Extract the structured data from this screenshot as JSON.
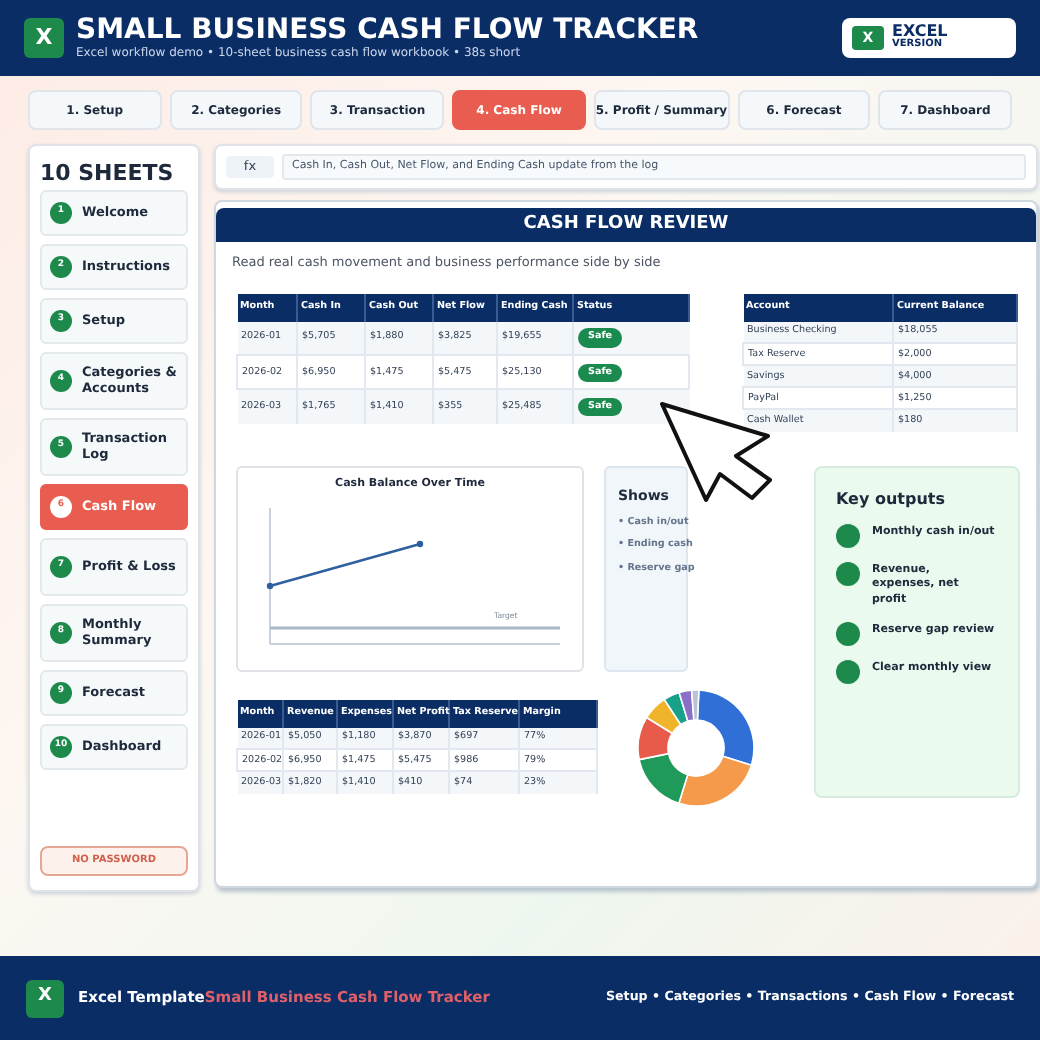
{
  "header": {
    "logo": "X",
    "title": "SMALL BUSINESS CASH FLOW TRACKER",
    "subtitle": "Excel workflow demo • 10-sheet business cash flow workbook • 38s short",
    "badge": {
      "logo": "X",
      "line1": "EXCEL",
      "line2": "VERSION"
    }
  },
  "tabs": [
    {
      "label": "1. Setup",
      "selected": false
    },
    {
      "label": "2. Categories",
      "selected": false
    },
    {
      "label": "3. Transaction",
      "selected": false
    },
    {
      "label": "4. Cash Flow",
      "selected": true
    },
    {
      "label": "5. Profit / Summary",
      "selected": false
    },
    {
      "label": "6. Forecast",
      "selected": false
    },
    {
      "label": "7. Dashboard",
      "selected": false
    }
  ],
  "sidebar": {
    "title": "10 SHEETS",
    "items": [
      {
        "number": "1",
        "label": "Welcome",
        "selected": false
      },
      {
        "number": "2",
        "label": "Instructions",
        "selected": false
      },
      {
        "number": "3",
        "label": "Setup",
        "selected": false
      },
      {
        "number": "4",
        "label": "Categories & Accounts",
        "selected": false
      },
      {
        "number": "5",
        "label": "Transaction Log",
        "selected": false
      },
      {
        "number": "6",
        "label": "Cash Flow",
        "selected": true
      },
      {
        "number": "7",
        "label": "Profit & Loss",
        "selected": false
      },
      {
        "number": "8",
        "label": "Monthly Summary",
        "selected": false
      },
      {
        "number": "9",
        "label": "Forecast",
        "selected": false
      },
      {
        "number": "10",
        "label": "Dashboard",
        "selected": false
      }
    ],
    "footer_button": "NO PASSWORD"
  },
  "formula_bar": {
    "fx": "fx",
    "text": "Cash In, Cash Out, Net Flow, and Ending Cash update from the log"
  },
  "review": {
    "title": "CASH FLOW REVIEW",
    "subtitle": "Read real cash movement and business performance side by side",
    "cash_table": {
      "columns": [
        "Month",
        "Cash In",
        "Cash Out",
        "Net Flow",
        "Ending Cash",
        "Status"
      ],
      "rows": [
        {
          "cells": [
            "2026-01",
            "$5,705",
            "$1,880",
            "$3,825",
            "$19,655"
          ],
          "status": "Safe"
        },
        {
          "cells": [
            "2026-02",
            "$6,950",
            "$1,475",
            "$5,475",
            "$25,130"
          ],
          "status": "Safe"
        },
        {
          "cells": [
            "2026-03",
            "$1,765",
            "$1,410",
            "$355",
            "$25,485"
          ],
          "status": "Safe"
        }
      ]
    },
    "accounts_table": {
      "columns": [
        "Account",
        "Current Balance"
      ],
      "rows": [
        [
          "Business Checking",
          "$18,055"
        ],
        [
          "Tax Reserve",
          "$2,000"
        ],
        [
          "Savings",
          "$4,000"
        ],
        [
          "PayPal",
          "$1,250"
        ],
        [
          "Cash Wallet",
          "$180"
        ]
      ]
    },
    "chart": {
      "title": "Cash Balance Over Time",
      "target_label": "Target"
    },
    "shows": {
      "title": "Shows",
      "items": [
        "• Cash in/out",
        "• Ending cash",
        "• Reserve gap"
      ]
    },
    "key_outputs": {
      "title": "Key outputs",
      "items": [
        "Monthly cash in/out",
        "Revenue, expenses, net profit",
        "Reserve gap review",
        "Clear monthly view"
      ]
    },
    "pl_table": {
      "columns": [
        "Month",
        "Revenue",
        "Expenses",
        "Net Profit",
        "Tax Reserve",
        "Margin"
      ],
      "rows": [
        [
          "2026-01",
          "$5,050",
          "$1,180",
          "$3,870",
          "$697",
          "77%"
        ],
        [
          "2026-02",
          "$6,950",
          "$1,475",
          "$5,475",
          "$986",
          "79%"
        ],
        [
          "2026-03",
          "$1,820",
          "$1,410",
          "$410",
          "$74",
          "23%"
        ]
      ]
    }
  },
  "footer": {
    "logo": "X",
    "brand": "Excel Template",
    "product": "Small Business Cash Flow Tracker",
    "links": "Setup • Categories • Transactions • Cash Flow • Forecast"
  }
}
